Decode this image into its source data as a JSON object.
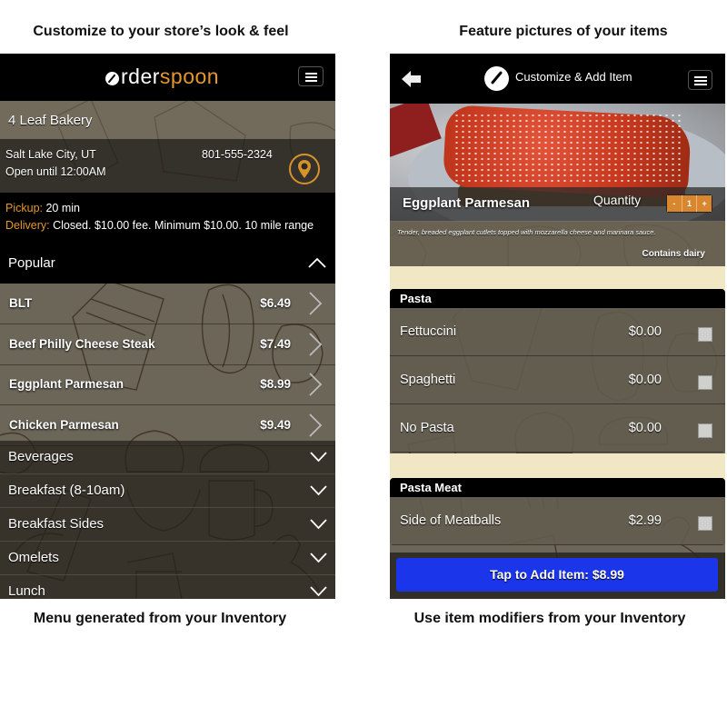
{
  "captions": {
    "top_left": "Customize to your store’s look & feel",
    "top_right": "Feature pictures of your items",
    "bottom_left": "Menu generated from your Inventory",
    "bottom_right": "Use item modifiers from your Inventory"
  },
  "left_screen": {
    "logo": {
      "part1": "rder",
      "part2": "spoon"
    },
    "menu_icon": "hamburger-icon",
    "store": {
      "name": "4 Leaf Bakery",
      "city": "Salt Lake City, UT",
      "hours": "Open until 12:00AM",
      "phone": "801-555-2324",
      "map_icon": "map-pin-icon"
    },
    "pickup": {
      "label": "Pickup:",
      "value": " 20 min"
    },
    "delivery": {
      "label": "Delivery:",
      "value": " Closed. $10.00 fee. Minimum $10.00. 10 mile range"
    },
    "expanded_category": {
      "name": "Popular",
      "items": [
        {
          "name": "BLT",
          "price": "$6.49"
        },
        {
          "name": "Beef Philly Cheese Steak",
          "price": "$7.49"
        },
        {
          "name": "Eggplant Parmesan",
          "price": "$8.99"
        },
        {
          "name": "Chicken Parmesan",
          "price": "$9.49"
        }
      ]
    },
    "collapsed_categories": [
      "Beverages",
      "Breakfast (8-10am)",
      "Breakfast Sides",
      "Omelets",
      "Lunch"
    ]
  },
  "right_screen": {
    "title": "Customize & Add Item",
    "item": {
      "name": "Eggplant Parmesan",
      "quantity_label": "Quantity",
      "quantity": "1",
      "decrement": "-",
      "increment": "+",
      "description": "Tender, breaded eggplant cutlets topped with mozzarella cheese and marinara sauce.",
      "dietary": "Contains dairy"
    },
    "modifier_groups": [
      {
        "name": "Pasta",
        "options": [
          {
            "name": "Fettuccini",
            "price": "$0.00",
            "checked": false
          },
          {
            "name": "Spaghetti",
            "price": "$0.00",
            "checked": false
          },
          {
            "name": "No Pasta",
            "price": "$0.00",
            "checked": false
          }
        ]
      },
      {
        "name": "Pasta Meat",
        "options": [
          {
            "name": "Side of Meatballs",
            "price": "$2.99",
            "checked": false
          }
        ]
      }
    ],
    "add_button": "Tap to Add Item: $8.99"
  },
  "colors": {
    "accent_orange": "#e4982b",
    "add_button_blue": "#1a35ea",
    "header_black": "#000000",
    "cream_background": "#f1e7c5"
  }
}
